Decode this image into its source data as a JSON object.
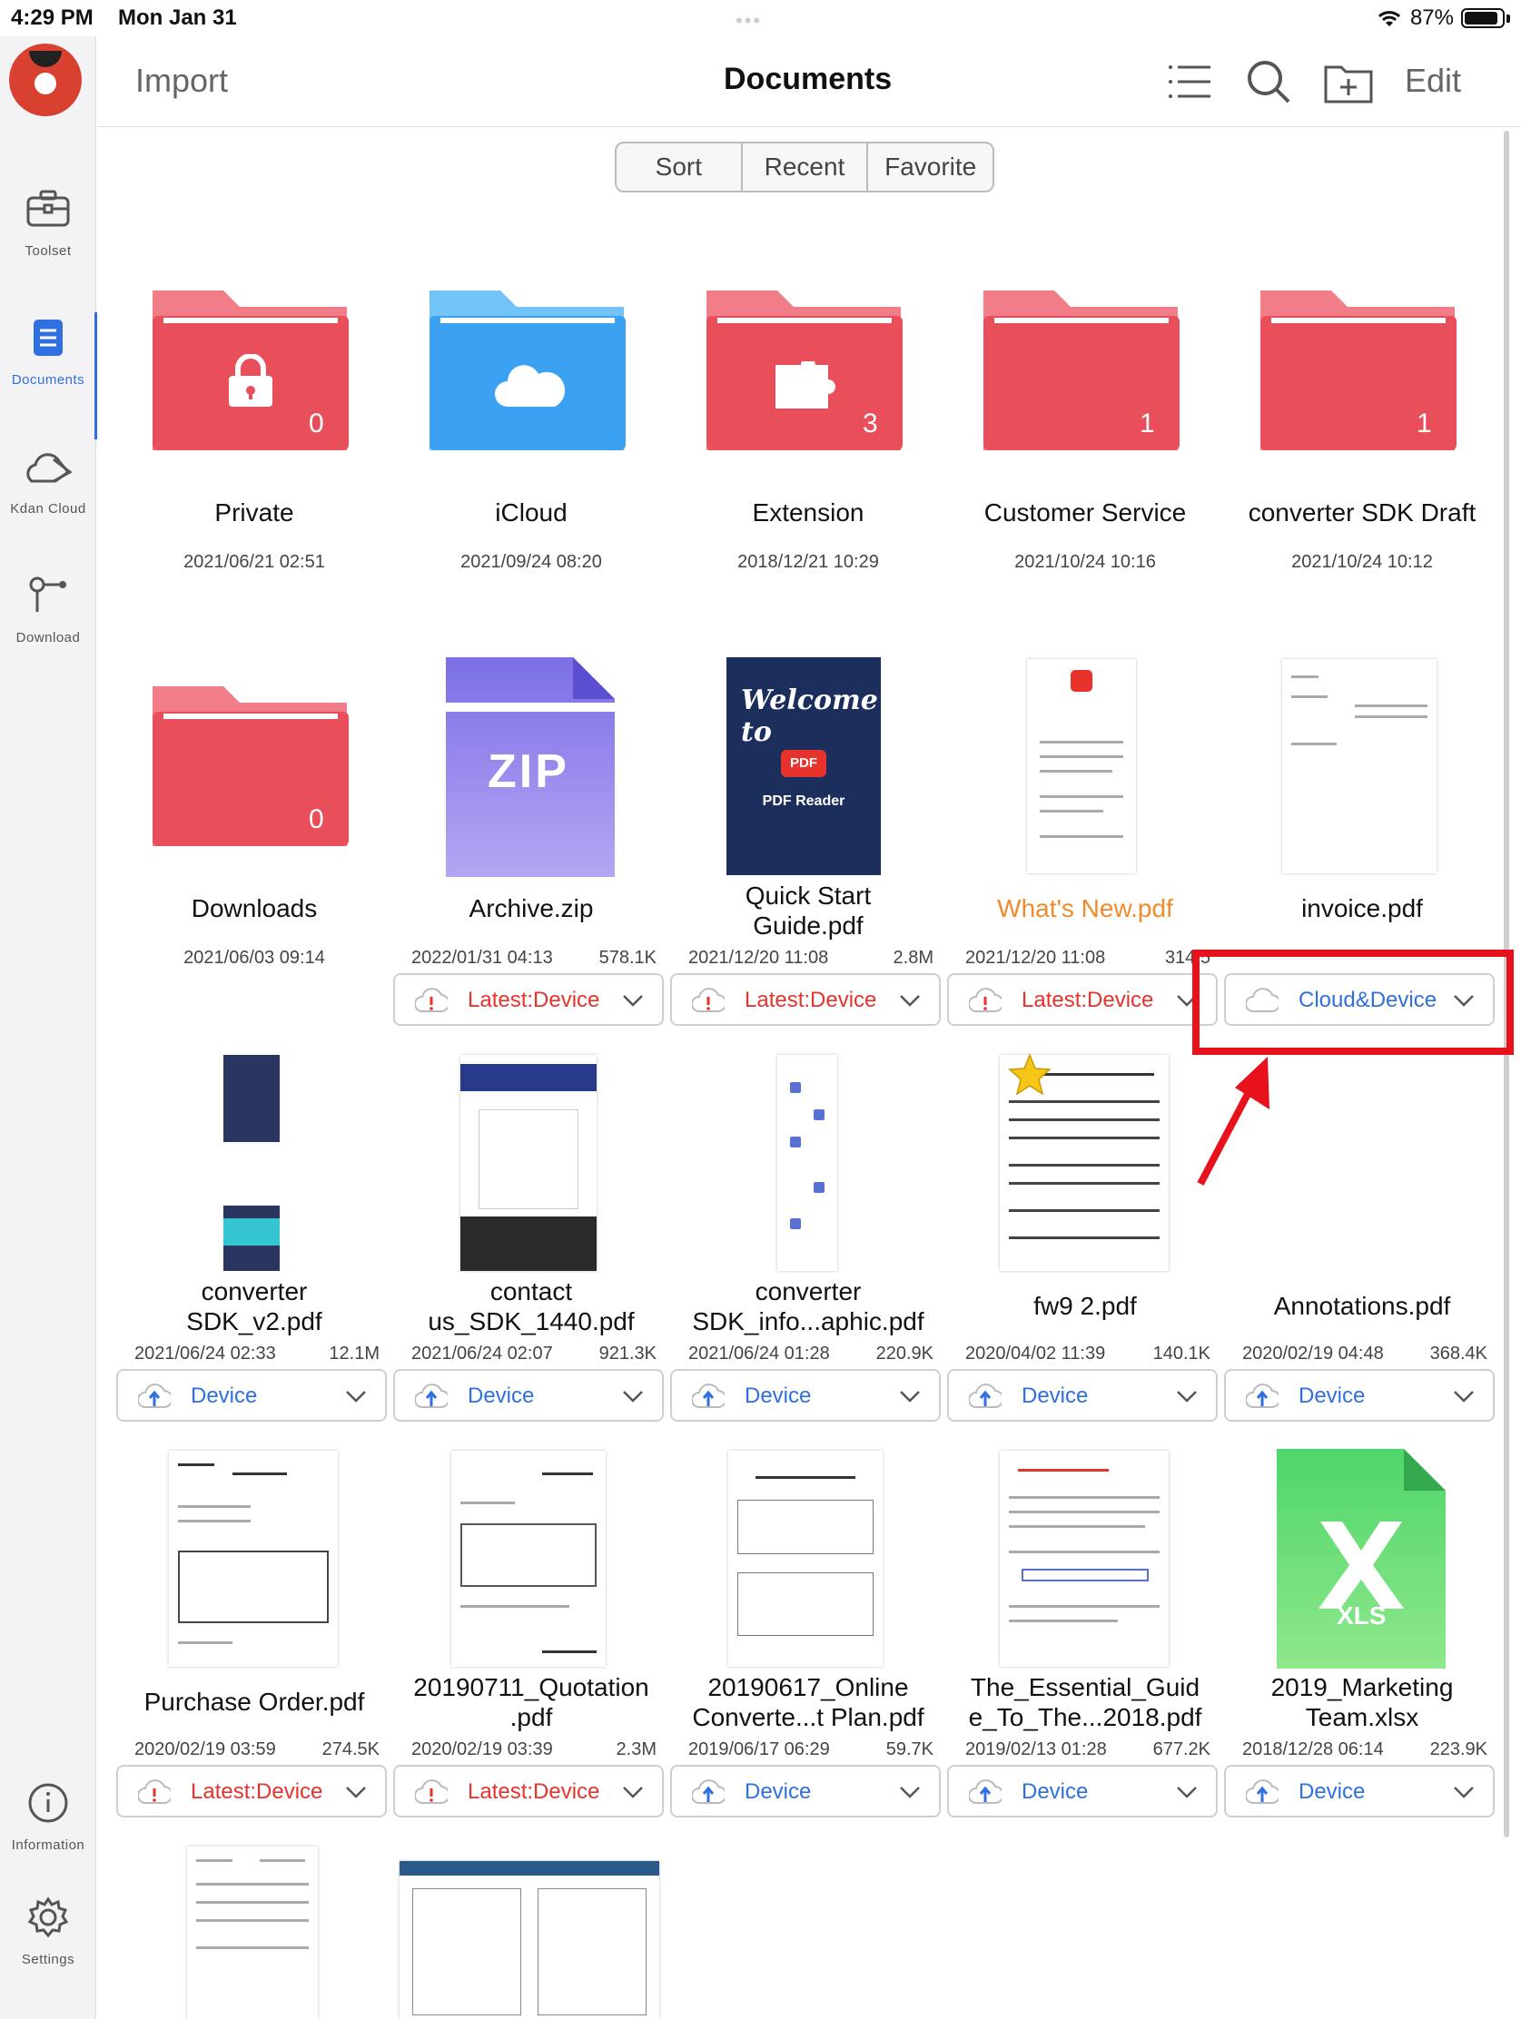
{
  "status_bar": {
    "time": "4:29 PM",
    "date": "Mon Jan 31",
    "battery": "87%"
  },
  "sidebar": {
    "items": [
      {
        "label": "Toolset"
      },
      {
        "label": "Documents"
      },
      {
        "label": "Kdan Cloud"
      },
      {
        "label": "Download"
      },
      {
        "label": "Information"
      },
      {
        "label": "Settings"
      }
    ]
  },
  "topnav": {
    "import": "Import",
    "title": "Documents",
    "edit": "Edit"
  },
  "segments": [
    "Sort",
    "Recent",
    "Favorite"
  ],
  "colors": {
    "folder_red": "#e84f5a",
    "folder_blue": "#3aa2f0",
    "accent_blue": "#2f6fe0",
    "alert_red": "#e8322c",
    "highlight_box": "#e8121c"
  },
  "folders": [
    {
      "name": "Private",
      "date": "2021/06/21 02:51",
      "count": "0",
      "icon": "lock-icon"
    },
    {
      "name": "iCloud",
      "date": "2021/09/24 08:20",
      "icon": "cloud-icon"
    },
    {
      "name": "Extension",
      "date": "2018/12/21 10:29",
      "count": "3",
      "icon": "puzzle-icon"
    },
    {
      "name": "Customer Service",
      "date": "2021/10/24 10:16",
      "count": "1"
    },
    {
      "name": "converter SDK Draft",
      "date": "2021/10/24 10:12",
      "count": "1"
    },
    {
      "name": "Downloads",
      "date": "2021/06/03 09:14",
      "count": "0"
    }
  ],
  "files": [
    {
      "name": "Archive.zip",
      "date": "2022/01/31 04:13",
      "size": "578.1K",
      "status": "Latest:Device",
      "zip_label": "ZIP"
    },
    {
      "name": "Quick Start Guide.pdf",
      "name1": "Quick Start",
      "name2": "Guide.pdf",
      "date": "2021/12/20 11:08",
      "size": "2.8M",
      "status": "Latest:Device",
      "cover_title": "Welcome to",
      "cover_badge": "PDF",
      "cover_sub": "PDF Reader"
    },
    {
      "name": "What's New.pdf",
      "date": "2021/12/20 11:08",
      "size": "314.5",
      "status": "Latest:Device"
    },
    {
      "name": "invoice.pdf",
      "status": "Cloud&Device"
    },
    {
      "name1": "converter",
      "name2": "SDK_v2.pdf",
      "date": "2021/06/24 02:33",
      "size": "12.1M",
      "status": "Device"
    },
    {
      "name1": "contact",
      "name2": "us_SDK_1440.pdf",
      "date": "2021/06/24 02:07",
      "size": "921.3K",
      "status": "Device"
    },
    {
      "name1": "converter",
      "name2": "SDK_info...aphic.pdf",
      "date": "2021/06/24 01:28",
      "size": "220.9K",
      "status": "Device"
    },
    {
      "name": "fw9 2.pdf",
      "date": "2020/04/02 11:39",
      "size": "140.1K",
      "status": "Device"
    },
    {
      "name": "Annotations.pdf",
      "date": "2020/02/19 04:48",
      "size": "368.4K",
      "status": "Device"
    },
    {
      "name": "Purchase Order.pdf",
      "date": "2020/02/19 03:59",
      "size": "274.5K",
      "status": "Latest:Device"
    },
    {
      "name1": "20190711_Quotation",
      "name2": ".pdf",
      "date": "2020/02/19 03:39",
      "size": "2.3M",
      "status": "Latest:Device"
    },
    {
      "name1": "20190617_Online",
      "name2": "Converte...t Plan.pdf",
      "date": "2019/06/17 06:29",
      "size": "59.7K",
      "status": "Device"
    },
    {
      "name1": "The_Essential_Guid",
      "name2": "e_To_The...2018.pdf",
      "date": "2019/02/13 01:28",
      "size": "677.2K",
      "status": "Device"
    },
    {
      "name1": "2019_Marketing",
      "name2": "Team.xlsx",
      "date": "2018/12/28 06:14",
      "size": "223.9K",
      "status": "Device",
      "xls_label": "XLS"
    }
  ]
}
